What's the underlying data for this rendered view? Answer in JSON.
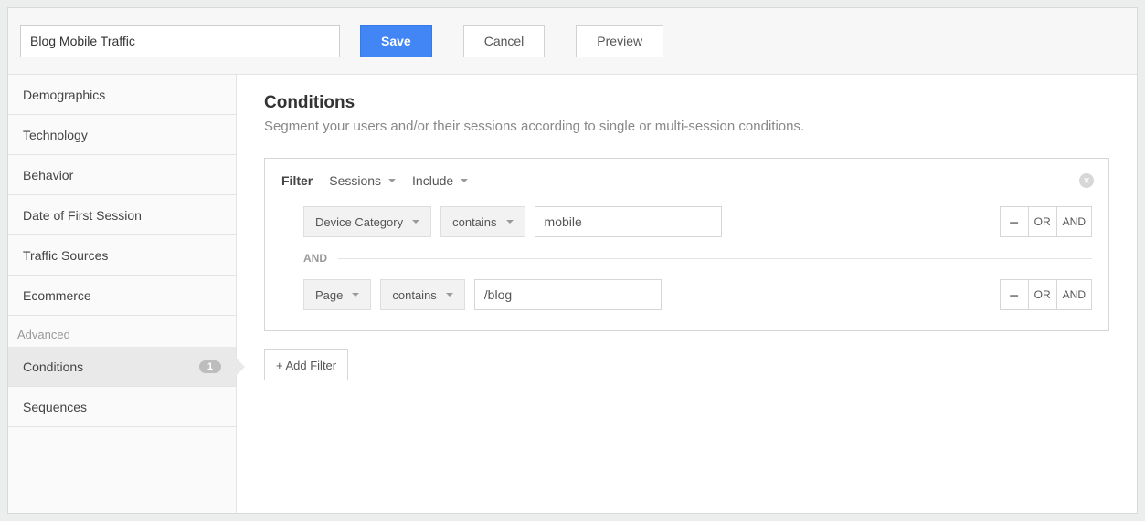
{
  "segment_name": "Blog Mobile Traffic",
  "buttons": {
    "save": "Save",
    "cancel": "Cancel",
    "preview": "Preview"
  },
  "sidebar": {
    "items": [
      {
        "label": "Demographics"
      },
      {
        "label": "Technology"
      },
      {
        "label": "Behavior"
      },
      {
        "label": "Date of First Session"
      },
      {
        "label": "Traffic Sources"
      },
      {
        "label": "Ecommerce"
      }
    ],
    "advanced_heading": "Advanced",
    "advanced": [
      {
        "label": "Conditions",
        "badge": "1"
      },
      {
        "label": "Sequences"
      }
    ]
  },
  "section": {
    "title": "Conditions",
    "desc": "Segment your users and/or their sessions according to single or multi-session conditions."
  },
  "filter": {
    "label": "Filter",
    "scope": "Sessions",
    "mode": "Include",
    "rows": [
      {
        "dimension": "Device Category",
        "operator": "contains",
        "value": "mobile"
      },
      {
        "dimension": "Page",
        "operator": "contains",
        "value": "/blog"
      }
    ],
    "and": "AND",
    "or": "OR",
    "minus": "–"
  },
  "add_filter": "+ Add Filter"
}
